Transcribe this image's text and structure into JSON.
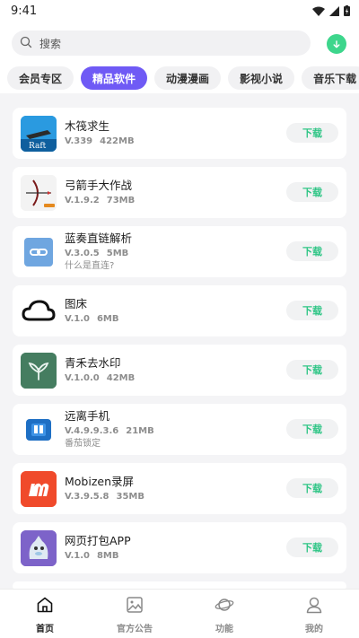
{
  "status_bar": {
    "time": "9:41"
  },
  "search": {
    "placeholder": "搜索"
  },
  "tabs": [
    {
      "label": "会员专区",
      "active": false
    },
    {
      "label": "精品软件",
      "active": true
    },
    {
      "label": "动漫漫画",
      "active": false
    },
    {
      "label": "影视小说",
      "active": false
    },
    {
      "label": "音乐下载",
      "active": false
    }
  ],
  "apps": [
    {
      "name": "木筏求生",
      "version": "V.339",
      "size": "422MB",
      "desc": "",
      "icon": "raft-icon",
      "download_label": "下载"
    },
    {
      "name": "弓箭手大作战",
      "version": "V.1.9.2",
      "size": "73MB",
      "desc": "",
      "icon": "archer-icon",
      "download_label": "下载"
    },
    {
      "name": "蓝奏直链解析",
      "version": "V.3.0.5",
      "size": "5MB",
      "desc": "什么是直连?",
      "icon": "link-icon",
      "download_label": "下载"
    },
    {
      "name": "图床",
      "version": "V.1.0",
      "size": "6MB",
      "desc": "",
      "icon": "cloud-icon",
      "download_label": "下载"
    },
    {
      "name": "青禾去水印",
      "version": "V.1.0.0",
      "size": "42MB",
      "desc": "",
      "icon": "sprout-icon",
      "download_label": "下载"
    },
    {
      "name": "远离手机",
      "version": "V.4.9.9.3.6",
      "size": "21MB",
      "desc": "番茄锁定",
      "icon": "lock-phone-icon",
      "download_label": "下载"
    },
    {
      "name": "Mobizen录屏",
      "version": "V.3.9.5.8",
      "size": "35MB",
      "desc": "",
      "icon": "mobizen-icon",
      "download_label": "下载"
    },
    {
      "name": "网页打包APP",
      "version": "V.1.0",
      "size": "8MB",
      "desc": "",
      "icon": "cartoon-icon",
      "download_label": "下载"
    }
  ],
  "bottom_nav": [
    {
      "label": "首页",
      "icon": "home-icon",
      "active": true
    },
    {
      "label": "官方公告",
      "icon": "image-icon",
      "active": false
    },
    {
      "label": "功能",
      "icon": "planet-icon",
      "active": false
    },
    {
      "label": "我的",
      "icon": "user-icon",
      "active": false
    }
  ],
  "colors": {
    "accent": "#6f5af5",
    "download": "#2ec585",
    "fab": "#3dd68c"
  }
}
